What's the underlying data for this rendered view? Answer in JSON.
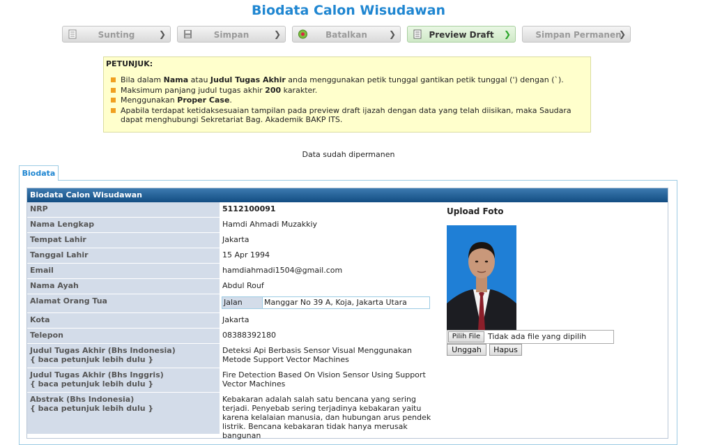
{
  "page": {
    "title": "Biodata Calon Wisudawan"
  },
  "toolbar": [
    {
      "label": "Sunting",
      "icon": "edit-document-icon",
      "active": false
    },
    {
      "label": "Simpan",
      "icon": "floppy-disk-icon",
      "active": false
    },
    {
      "label": "Batalkan",
      "icon": "cancel-circle-icon",
      "active": false
    },
    {
      "label": "Preview Draft",
      "icon": "preview-document-icon",
      "active": true
    },
    {
      "label": "Simpan Permanen",
      "icon": "",
      "active": false
    }
  ],
  "instructions": {
    "heading": "PETUNJUK:",
    "items": [
      [
        "Bila dalam ",
        "Nama",
        " atau ",
        "Judul Tugas Akhir",
        " anda menggunakan petik tunggal gantikan petik tunggal (') dengan (`)."
      ],
      [
        "Maksimum panjang judul tugas akhir ",
        "200",
        " karakter."
      ],
      [
        "Menggunakan ",
        "Proper Case",
        "."
      ],
      [
        "Apabila terdapat ketidaksesuaian tampilan pada preview draft ijazah dengan data yang telah diisikan, maka Saudara dapat menghubungi Sekretariat Bag. Akademik BAKP ITS."
      ]
    ]
  },
  "status_message": "Data sudah dipermanen",
  "tab_label": "Biodata",
  "section_header": "Biodata Calon Wisudawan",
  "fields": {
    "nrp": {
      "label": "NRP",
      "value": "5112100091"
    },
    "nama": {
      "label": "Nama Lengkap",
      "value": "Hamdi Ahmadi Muzakkiy"
    },
    "tempat_lahir": {
      "label": "Tempat Lahir",
      "value": "Jakarta"
    },
    "tanggal_lahir": {
      "label": "Tanggal Lahir",
      "value": "15 Apr 1994"
    },
    "email": {
      "label": "Email",
      "value": "hamdiahmadi1504@gmail.com"
    },
    "nama_ayah": {
      "label": "Nama Ayah",
      "value": "Abdul Rouf"
    },
    "alamat": {
      "label": "Alamat Orang Tua",
      "key": "Jalan",
      "value": "Manggar No 39 A, Koja, Jakarta Utara"
    },
    "kota": {
      "label": "Kota",
      "value": "Jakarta"
    },
    "telepon": {
      "label": "Telepon",
      "value": "08388392180"
    },
    "judul_id": {
      "label": "Judul Tugas Akhir (Bhs Indonesia)",
      "hint": "{ baca petunjuk lebih dulu }",
      "value": "Deteksi Api Berbasis Sensor Visual Menggunakan Metode Support Vector Machines"
    },
    "judul_en": {
      "label": "Judul Tugas Akhir (Bhs Inggris)",
      "hint": "{ baca petunjuk lebih dulu }",
      "value": "Fire Detection Based On Vision Sensor Using Support Vector Machines"
    },
    "abstrak_id": {
      "label": "Abstrak (Bhs Indonesia)",
      "hint": "{ baca petunjuk lebih dulu }",
      "value": "Kebakaran adalah salah satu bencana yang sering terjadi. Penyebab sering terjadinya kebakaran yaitu karena kelalaian manusia, dan hubungan arus pendek listrik. Bencana kebakaran tidak hanya merusak bangunan"
    }
  },
  "upload": {
    "title": "Upload Foto",
    "choose_label": "Pilih File",
    "no_file": "Tidak ada file yang dipilih",
    "upload_label": "Unggah",
    "delete_label": "Hapus"
  }
}
